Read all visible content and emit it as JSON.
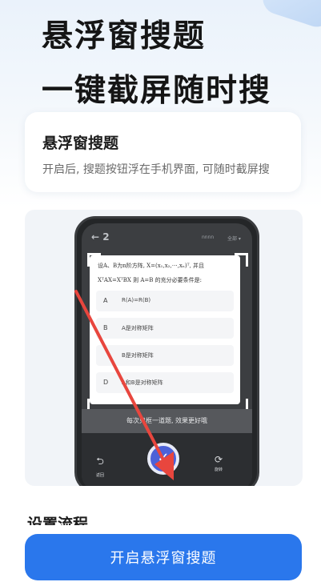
{
  "hero": {
    "line1": "悬浮窗搜题",
    "line2": "一键截屏随时搜"
  },
  "info_card": {
    "title": "悬浮窗搜题",
    "description": "开启后, 搜题按钮浮在手机界面, 可随时截屏搜"
  },
  "demo": {
    "status_left": "← 2",
    "status_mid": "nnnn",
    "status_right": "全部 ▾",
    "question_line1": "设A、B为n阶方阵, X=(x₁,x₂,⋯,xₙ)ᵀ, 并且",
    "question_line2": "XᵀAX=XᵀBX 则 A=B 的充分必要条件是:",
    "options": [
      {
        "letter": "A",
        "text": "R(A)=R(B)"
      },
      {
        "letter": "B",
        "text": "A是对称矩阵"
      },
      {
        "letter": "",
        "text": "B是对称矩阵"
      },
      {
        "letter": "D",
        "text": "A和B是对称矩阵"
      }
    ],
    "tip": "每次只框一道题, 效果更好哦",
    "back_label": "返回",
    "rotate_label": "旋转",
    "icons": {
      "back": "back-arrow-icon",
      "rotate": "rotate-icon",
      "shutter": "checkmark-icon"
    }
  },
  "section_heading": "设置流程",
  "cta_label": "开启悬浮窗搜题",
  "colors": {
    "accent": "#2a77ec",
    "arrow": "#e8463e",
    "shutter": "#4c61d8"
  }
}
